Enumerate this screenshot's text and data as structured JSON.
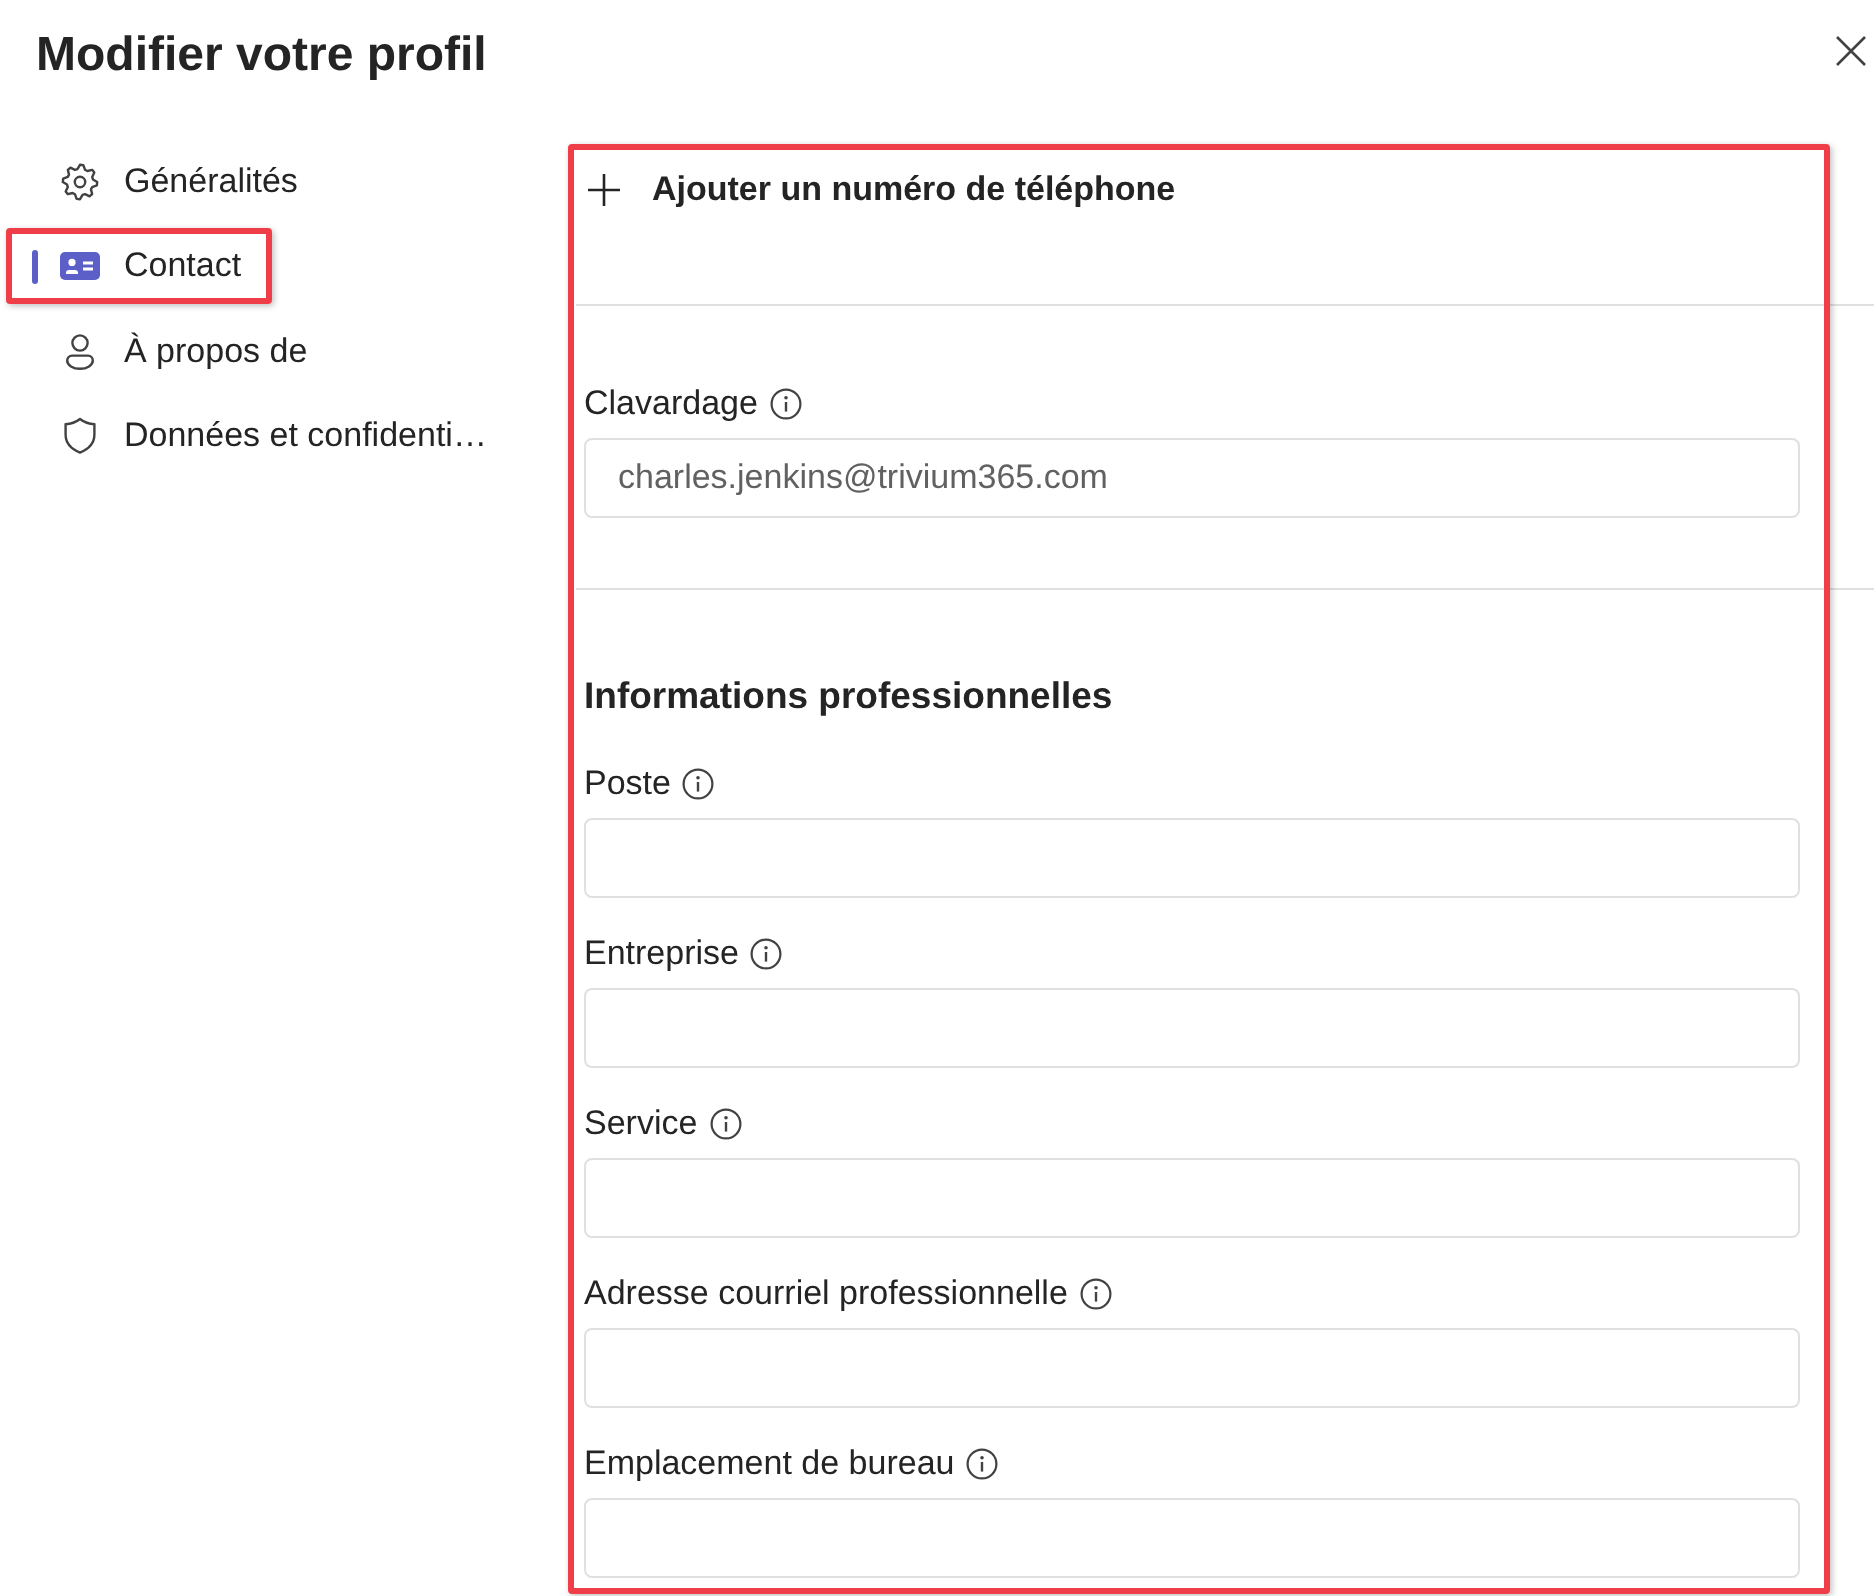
{
  "dialog": {
    "title": "Modifier votre profil"
  },
  "nav": {
    "items": [
      {
        "kind": "general",
        "label": "Généralités",
        "selected": false,
        "highlighted": false
      },
      {
        "kind": "contact",
        "label": "Contact",
        "selected": true,
        "highlighted": true
      },
      {
        "kind": "about",
        "label": "À propos de",
        "selected": false,
        "highlighted": false
      },
      {
        "kind": "privacy",
        "label": "Données et confidenti…",
        "selected": false,
        "highlighted": false
      }
    ]
  },
  "form": {
    "highlighted": true,
    "add_phone": {
      "label": "Ajouter un numéro de téléphone"
    },
    "chat": {
      "label": "Clavardage",
      "value": "charles.jenkins@trivium365.com"
    },
    "work_info": {
      "title": "Informations professionnelles",
      "fields": [
        {
          "label": "Poste"
        },
        {
          "label": "Entreprise"
        },
        {
          "label": "Service"
        },
        {
          "label": "Adresse courriel professionnelle"
        },
        {
          "label": "Emplacement de bureau"
        }
      ]
    }
  }
}
